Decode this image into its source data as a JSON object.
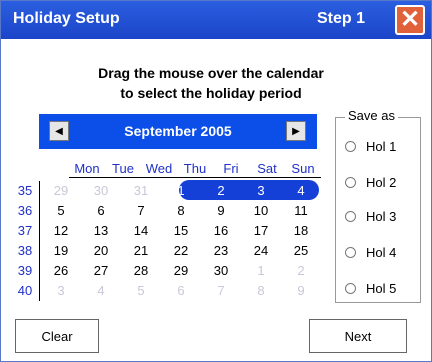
{
  "window": {
    "title": "Holiday Setup",
    "step": "Step 1"
  },
  "instructions": {
    "line1": "Drag the mouse over the calendar",
    "line2": "to select the holiday period"
  },
  "calendar": {
    "month_label": "September 2005",
    "prev_glyph": "◀",
    "next_glyph": "▶",
    "weekday_headers": [
      "Mon",
      "Tue",
      "Wed",
      "Thu",
      "Fri",
      "Sat",
      "Sun"
    ],
    "week_numbers": [
      "35",
      "36",
      "37",
      "38",
      "39",
      "40"
    ],
    "weeks": [
      [
        "29",
        "30",
        "31",
        "1",
        "2",
        "3",
        "4"
      ],
      [
        "5",
        "6",
        "7",
        "8",
        "9",
        "10",
        "11"
      ],
      [
        "12",
        "13",
        "14",
        "15",
        "16",
        "17",
        "18"
      ],
      [
        "19",
        "20",
        "21",
        "22",
        "23",
        "24",
        "25"
      ],
      [
        "26",
        "27",
        "28",
        "29",
        "30",
        "1",
        "2"
      ],
      [
        "3",
        "4",
        "5",
        "6",
        "7",
        "8",
        "9"
      ]
    ],
    "selected_range": [
      "1",
      "2",
      "3",
      "4"
    ]
  },
  "save_as": {
    "caption": "Save as",
    "options": [
      "Hol 1",
      "Hol 2",
      "Hol 3",
      "Hol 4",
      "Hol 5"
    ]
  },
  "buttons": {
    "clear": "Clear",
    "next": "Next"
  }
}
